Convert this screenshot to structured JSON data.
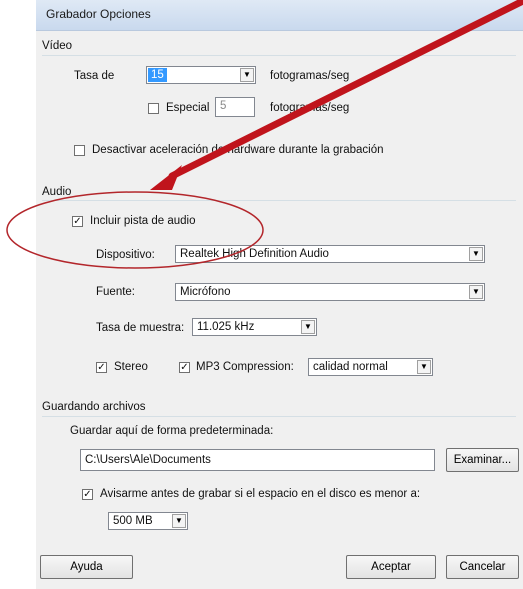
{
  "window": {
    "title": "Grabador Opciones"
  },
  "video": {
    "section_label": "Vídeo",
    "rate_label": "Tasa de",
    "rate_value": "15",
    "rate_unit": "fotogramas/seg",
    "special_label": "Especial",
    "special_checked": false,
    "special_value": "5",
    "special_unit": "fotogramas/seg",
    "disable_hw_label": "Desactivar aceleración de hardware durante la grabación",
    "disable_hw_checked": false
  },
  "audio": {
    "section_label": "Audio",
    "include_label": "Incluir pista de audio",
    "include_checked": true,
    "device_label": "Dispositivo:",
    "device_value": "Realtek High Definition Audio",
    "source_label": "Fuente:",
    "source_value": "Micrófono",
    "sample_rate_label": "Tasa de muestra:",
    "sample_rate_value": "11.025 kHz",
    "stereo_label": "Stereo",
    "stereo_checked": true,
    "mp3_label": "MP3 Compression:",
    "mp3_checked": true,
    "quality_value": "calidad normal"
  },
  "saving": {
    "section_label": "Guardando archivos",
    "default_label": "Guardar aquí de forma predeterminada:",
    "path_value": "C:\\Users\\Ale\\Documents",
    "browse_label": "Examinar...",
    "warn_label": "Avisarme antes de grabar si el espacio en el disco es menor a:",
    "warn_checked": true,
    "size_value": "500 MB"
  },
  "buttons": {
    "help": "Ayuda",
    "ok": "Aceptar",
    "cancel": "Cancelar"
  },
  "annotation": {
    "arrow_color": "#c0141c",
    "ellipse_color": "#b3262b"
  },
  "icons": {
    "dropdown": "chevron-down-icon",
    "check": "check-icon"
  },
  "glyphs": {
    "check": "✓",
    "arrow": "▼"
  }
}
